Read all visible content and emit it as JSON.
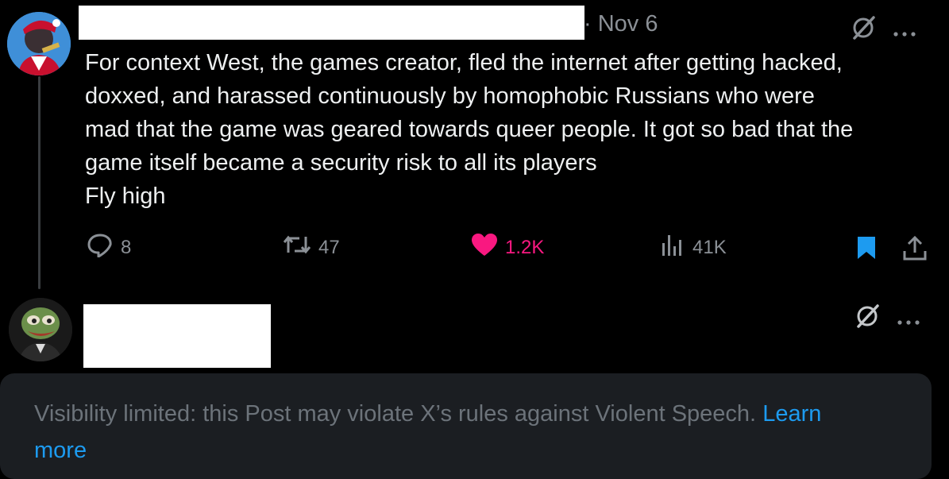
{
  "post": {
    "date": "· Nov 6",
    "text": [
      "For context West, the games creator, fled the internet after getting hacked,",
      "doxxed, and harassed continuously by homophobic Russians who were",
      "mad that the game was geared towards queer people. It got so bad that the",
      "game itself became a security risk to all its players",
      "Fly high"
    ],
    "actions": {
      "replies": "8",
      "reposts": "47",
      "likes": "1.2K",
      "views": "41K"
    }
  },
  "notice": {
    "text": "Visibility limited: this Post may violate X’s rules against Violent Speech.",
    "link_word1": "Learn",
    "link_word2": "more"
  },
  "colors": {
    "background": "#000000",
    "like": "#f91880",
    "link": "#1d9bf0",
    "muted": "#8b9096",
    "notice_bg": "#1b1e22"
  },
  "icons": [
    "grok-icon",
    "more-icon",
    "reply-icon",
    "repost-icon",
    "like-icon",
    "views-icon",
    "bookmark-icon",
    "share-icon"
  ]
}
